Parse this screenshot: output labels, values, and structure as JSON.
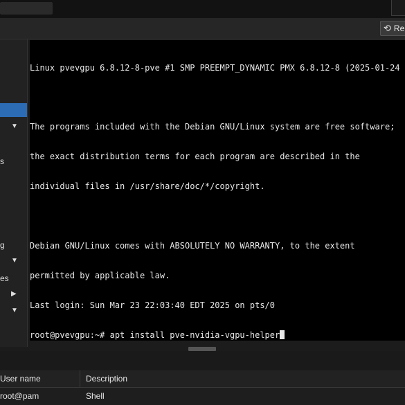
{
  "toolbar": {
    "reload_label": "Rel",
    "reload_icon": "reload-icon"
  },
  "sidebar": {
    "items": [
      {
        "label": "",
        "active": true
      },
      {
        "label": "s"
      },
      {
        "label": "g"
      },
      {
        "label": "es"
      }
    ]
  },
  "terminal": {
    "lines": [
      "Linux pvevgpu 6.8.12-8-pve #1 SMP PREEMPT_DYNAMIC PMX 6.8.12-8 (2025-01-24",
      "",
      "The programs included with the Debian GNU/Linux system are free software;",
      "the exact distribution terms for each program are described in the",
      "individual files in /usr/share/doc/*/copyright.",
      "",
      "Debian GNU/Linux comes with ABSOLUTELY NO WARRANTY, to the extent",
      "permitted by applicable law.",
      "Last login: Sun Mar 23 22:03:40 EDT 2025 on pts/0"
    ],
    "prompt": "root@pvevgpu:~# ",
    "command": "apt install pve-nvidia-vgpu-helper"
  },
  "table": {
    "headers": [
      "User name",
      "Description"
    ],
    "rows": [
      [
        "root@pam",
        "Shell"
      ]
    ]
  }
}
